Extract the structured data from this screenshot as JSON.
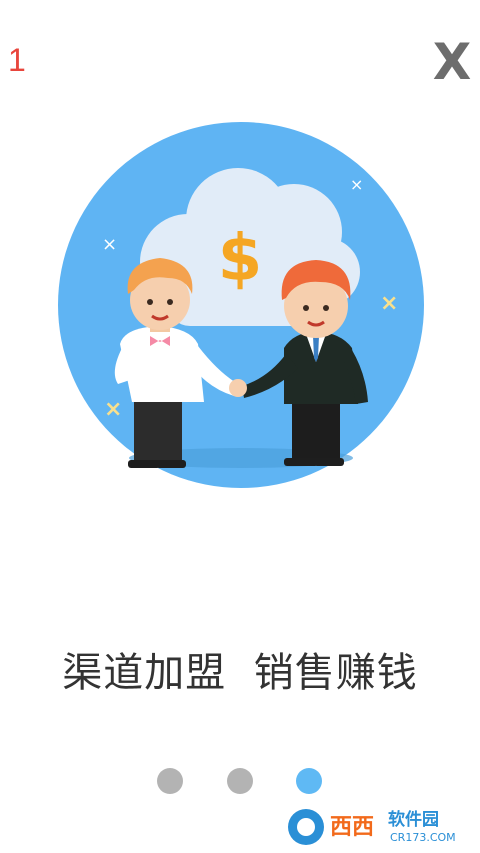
{
  "header": {
    "page_number": "1",
    "close_label": "X"
  },
  "illustration": {
    "cloud_symbol": "$",
    "sparkle_icon": "×",
    "colors": {
      "circle_bg": "#5fb4f3",
      "cloud": "#e1ecf8",
      "dollar": "#f5a623",
      "hair": "#f4a24f"
    }
  },
  "slogan": "渠道加盟  销售赚钱",
  "pager": {
    "total": 3,
    "active_index": 2,
    "inactive_color": "#b3b3b3",
    "active_color": "#5fb9f4"
  },
  "watermark": {
    "brand": "西西",
    "tagline": "软件园",
    "url": "CR173.COM"
  }
}
